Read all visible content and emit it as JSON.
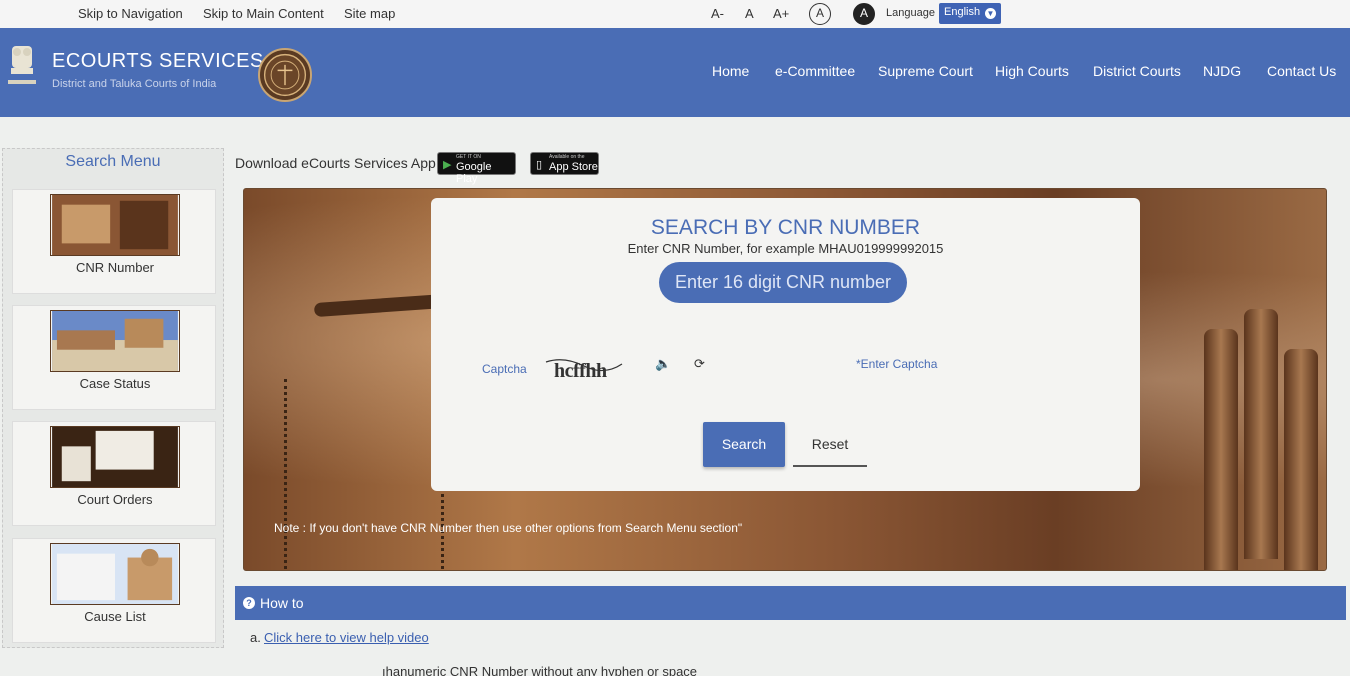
{
  "topbar": {
    "skip_nav": "Skip to Navigation",
    "skip_main": "Skip to Main Content",
    "sitemap": "Site map",
    "font_decrease": "A-",
    "font_normal": "A",
    "font_increase": "A+",
    "contrast_light": "A",
    "contrast_dark": "A",
    "language_label": "Language",
    "language_value": "English"
  },
  "header": {
    "title": "ECOURTS SERVICES",
    "subtitle": "District and Taluka Courts of India",
    "nav": [
      "Home",
      "e-Committee",
      "Supreme Court",
      "High Courts",
      "District Courts",
      "NJDG",
      "Contact Us"
    ]
  },
  "sidebar": {
    "title": "Search Menu",
    "items": [
      {
        "label": "CNR Number"
      },
      {
        "label": "Case Status"
      },
      {
        "label": "Court Orders"
      },
      {
        "label": "Cause List"
      }
    ]
  },
  "download": {
    "text": "Download eCourts Services App :",
    "google_small": "GET IT ON",
    "google_big": "Google Play",
    "apple_small": "Available on the",
    "apple_big": "App Store"
  },
  "search_card": {
    "title": "SEARCH BY CNR NUMBER",
    "hint": "Enter CNR Number, for example MHAU019999992015",
    "cnr_placeholder": "Enter 16 digit CNR number",
    "captcha_label": "Captcha",
    "captcha_text": "hcffhh",
    "captcha_placeholder": "*Enter Captcha",
    "search_button": "Search",
    "reset_button": "Reset"
  },
  "hero_note": "Note : If you don't have CNR Number then use other options from Search Menu section\"",
  "howto": {
    "title": "How to",
    "item_prefix": "a.",
    "item_link": "Click here to view help video",
    "tip": "ıhanumeric CNR Number without any hyphen or space"
  },
  "colors": {
    "accent": "#4a6db5",
    "background": "#eef0ee"
  }
}
